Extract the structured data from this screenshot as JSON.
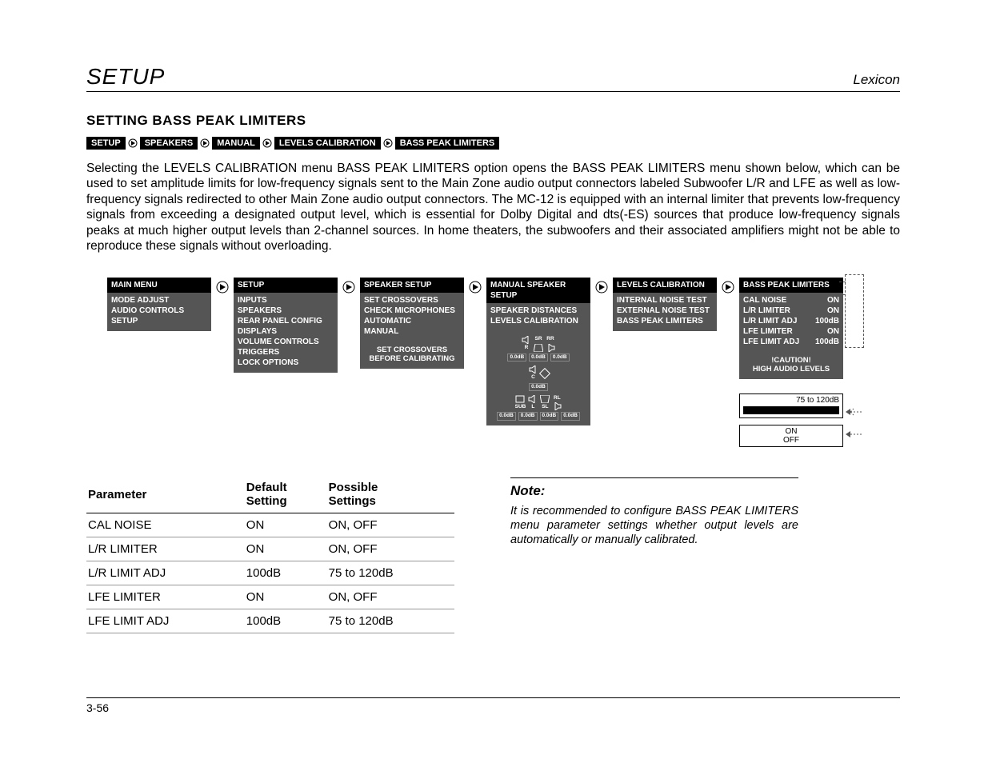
{
  "header": {
    "title": "SETUP",
    "brand": "Lexicon"
  },
  "section_title": "SETTING BASS PEAK LIMITERS",
  "breadcrumb": [
    "SETUP",
    "SPEAKERS",
    "MANUAL",
    "LEVELS CALIBRATION",
    "BASS PEAK LIMITERS"
  ],
  "body_text": "Selecting the LEVELS CALIBRATION menu BASS PEAK LIMITERS option opens the BASS PEAK LIMITERS menu shown below, which can be used to set amplitude limits for low-frequency signals sent to the Main Zone audio output connectors labeled Subwoofer L/R and LFE as well as low-frequency signals redirected to other Main Zone audio output connectors. The MC-12 is equipped with an internal limiter that prevents low-frequency signals from exceeding a designated output level, which is essential for Dolby Digital and dts(-ES) sources that produce low-frequency signals peaks at much higher output levels than 2-channel sources. In home theaters, the subwoofers and their associated amplifiers might not be able to reproduce these signals without overloading.",
  "menus": {
    "main": {
      "title": "MAIN MENU",
      "items": [
        "MODE ADJUST",
        "AUDIO CONTROLS",
        "SETUP"
      ]
    },
    "setup": {
      "title": "SETUP",
      "items": [
        "INPUTS",
        "SPEAKERS",
        "REAR PANEL CONFIG",
        "DISPLAYS",
        "VOLUME CONTROLS",
        "TRIGGERS",
        "LOCK OPTIONS"
      ]
    },
    "speaker_setup": {
      "title": "SPEAKER SETUP",
      "items": [
        "SET CROSSOVERS",
        "CHECK MICROPHONES",
        "AUTOMATIC",
        "MANUAL"
      ],
      "hint1": "SET CROSSOVERS",
      "hint2": "BEFORE CALIBRATING"
    },
    "manual_spk": {
      "title": "MANUAL SPEAKER SETUP",
      "items": [
        "SPEAKER DISTANCES",
        "LEVELS CALIBRATION"
      ],
      "spk_val": "0.0dB",
      "spk_labels": {
        "r": "R",
        "sr": "SR",
        "rr": "RR",
        "c": "C",
        "sub": "SUB",
        "l": "L",
        "sl": "SL",
        "rl": "RL"
      }
    },
    "levels_cal": {
      "title": "LEVELS CALIBRATION",
      "items": [
        "INTERNAL NOISE TEST",
        "EXTERNAL NOISE TEST",
        "BASS PEAK LIMITERS"
      ]
    },
    "bpl": {
      "title": "BASS PEAK LIMITERS",
      "rows": [
        {
          "label": "CAL NOISE",
          "value": "ON"
        },
        {
          "label": "L/R LIMITER",
          "value": "ON"
        },
        {
          "label": "L/R LIMIT ADJ",
          "value": "100dB"
        },
        {
          "label": "LFE LIMITER",
          "value": "ON"
        },
        {
          "label": "LFE LIMIT ADJ",
          "value": "100dB"
        }
      ],
      "caution1": "!CAUTION!",
      "caution2": "HIGH AUDIO LEVELS",
      "range_label": "75 to 120dB",
      "onoff_on": "ON",
      "onoff_off": "OFF"
    }
  },
  "chart_data": {
    "type": "table",
    "columns": [
      "Parameter",
      "Default Setting",
      "Possible Settings"
    ],
    "rows": [
      [
        "CAL NOISE",
        "ON",
        "ON, OFF"
      ],
      [
        "L/R LIMITER",
        "ON",
        "ON, OFF"
      ],
      [
        "L/R LIMIT ADJ",
        "100dB",
        "75 to 120dB"
      ],
      [
        "LFE LIMITER",
        "ON",
        "ON, OFF"
      ],
      [
        "LFE LIMIT ADJ",
        "100dB",
        "75 to 120dB"
      ]
    ]
  },
  "note": {
    "title": "Note:",
    "body": "It is recommended to configure BASS PEAK LIMITERS menu parameter settings whether output levels are automatically or manually calibrated."
  },
  "page_num": "3-56"
}
